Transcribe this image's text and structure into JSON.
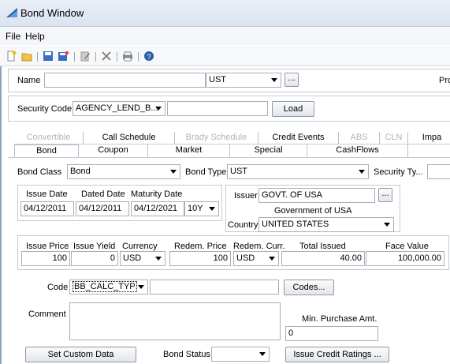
{
  "window": {
    "title": "Bond Window"
  },
  "menu": {
    "file": "File",
    "help": "Help"
  },
  "toolbar_icons": [
    "new-icon",
    "open-icon",
    "save-icon",
    "save-as-icon",
    "edit-icon",
    "delete-icon",
    "print-icon",
    "help-icon"
  ],
  "name_row": {
    "label": "Name",
    "name_value": "",
    "ticker_value": "UST",
    "more": "...",
    "right_cut": "Pro"
  },
  "security_row": {
    "label": "Security Code",
    "code_value": "AGENCY_LEND_B...",
    "search_value": "",
    "load": "Load"
  },
  "tabs_top": [
    {
      "label": "Convertible",
      "disabled": true
    },
    {
      "label": "Call Schedule",
      "disabled": false
    },
    {
      "label": "Brady Schedule",
      "disabled": true
    },
    {
      "label": "Credit Events",
      "disabled": false
    },
    {
      "label": "ABS",
      "disabled": true
    },
    {
      "label": "CLN",
      "disabled": true
    },
    {
      "label": "Impa",
      "disabled": false
    }
  ],
  "tabs_bottom": [
    "Bond",
    "Coupon",
    "Market",
    "Special",
    "CashFlows"
  ],
  "class_row": {
    "bond_class_label": "Bond Class",
    "bond_class_value": "Bond",
    "bond_type_label": "Bond Type",
    "bond_type_value": "UST",
    "security_type_label": "Security Ty..."
  },
  "dates": {
    "issue_label": "Issue Date",
    "dated_label": "Dated Date",
    "maturity_label": "Maturity Date",
    "issue": "04/12/2011",
    "dated": "04/12/2011",
    "maturity": "04/12/2021",
    "tenor": "10Y"
  },
  "issuer": {
    "label": "Issuer",
    "value": "GOVT. OF USA",
    "more": "...",
    "full_name": "Government of USA",
    "country_label": "Country",
    "country_value": "UNITED STATES"
  },
  "pricing": {
    "issue_price_label": "Issue Price",
    "issue_price": "100",
    "issue_yield_label": "Issue Yield",
    "issue_yield": "0",
    "currency_label": "Currency",
    "currency": "USD",
    "redem_price_label": "Redem. Price",
    "redem_price": "100",
    "redem_curr_label": "Redem. Curr.",
    "redem_curr": "USD",
    "total_issued_label": "Total Issued",
    "total_issued": "40.00",
    "face_value_label": "Face Value",
    "face_value": "100,000.00"
  },
  "code_row": {
    "label": "Code",
    "value": "BB_CALC_TYP",
    "text_value": "",
    "codes": "Codes..."
  },
  "comment": {
    "label": "Comment",
    "value": "",
    "min_purchase_label": "Min. Purchase Amt.",
    "min_purchase": "0"
  },
  "bottom": {
    "custom_data": "Set Custom Data",
    "bond_status_label": "Bond Status",
    "bond_status_value": "",
    "credit_ratings": "Issue Credit Ratings ..."
  },
  "colors": {
    "title_bg": "#dbe4f1",
    "menu_bg": "#f4f6fb",
    "border": "#c4c9d1"
  }
}
